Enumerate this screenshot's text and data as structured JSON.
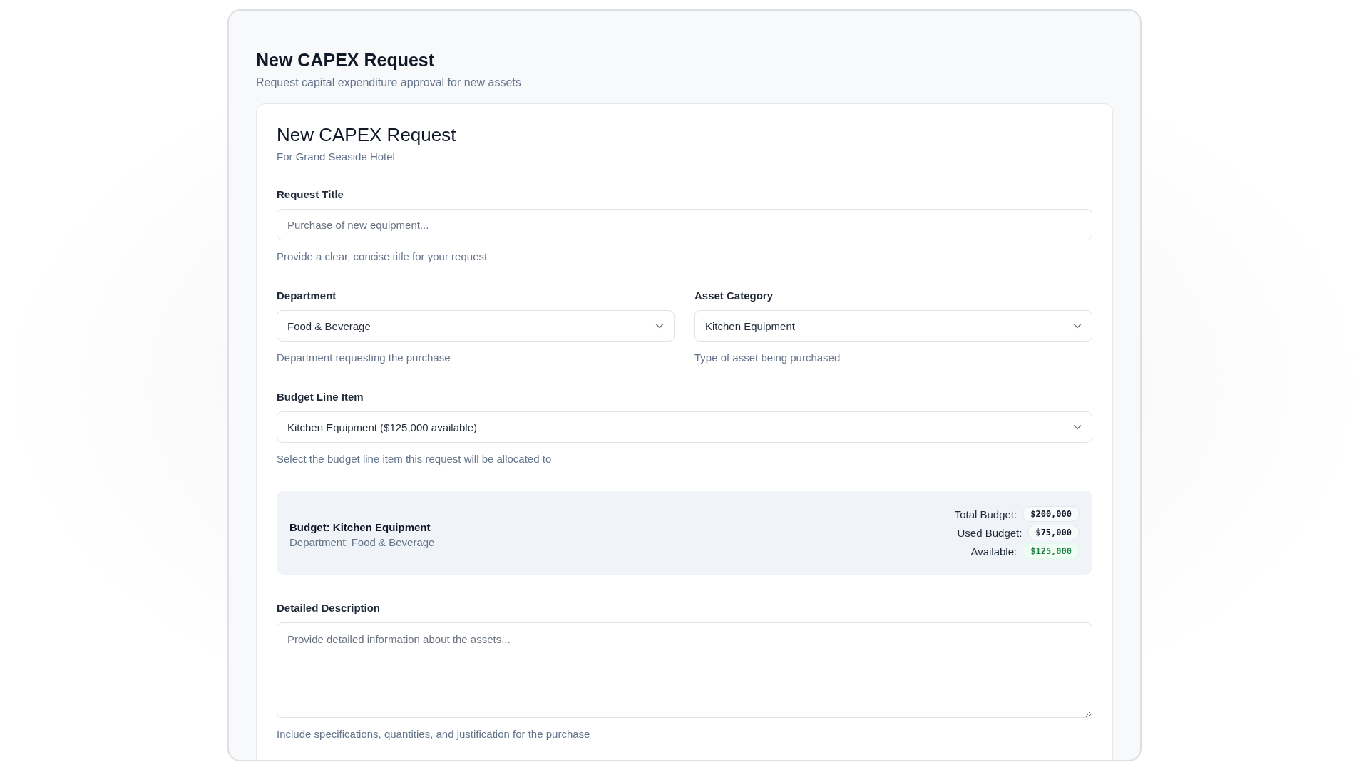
{
  "page": {
    "title": "New CAPEX Request",
    "subtitle": "Request capital expenditure approval for new assets"
  },
  "card": {
    "title": "New CAPEX Request",
    "subtitle": "For Grand Seaside Hotel",
    "rows": [
      [
        {
          "kind": "text",
          "label": "Request Title",
          "placeholder": "Purchase of new equipment...",
          "help": "Provide a clear, concise title for your request"
        }
      ],
      [
        {
          "kind": "select",
          "label": "Department",
          "value": "Food & Beverage",
          "help": "Department requesting the purchase"
        },
        {
          "kind": "select",
          "label": "Asset Category",
          "value": "Kitchen Equipment",
          "help": "Type of asset being purchased"
        }
      ],
      [
        {
          "kind": "select",
          "label": "Budget Line Item",
          "value": "Kitchen Equipment ($125,000 available)",
          "help": "Select the budget line item this request will be allocated to"
        }
      ],
      [
        {
          "kind": "budget",
          "title": "Budget: Kitchen Equipment",
          "subtitle": "Department: Food & Beverage",
          "stats": [
            {
              "label": "Total Budget:",
              "value": "$200,000",
              "highlighted": false
            },
            {
              "label": "Used Budget:",
              "value": "$75,000",
              "highlighted": false
            },
            {
              "label": "Available:",
              "value": "$125,000",
              "highlighted": true
            }
          ]
        }
      ],
      [
        {
          "kind": "textarea",
          "label": "Detailed Description",
          "placeholder": "Provide detailed information about the assets...",
          "help": "Include specifications, quantities, and justification for the purchase"
        }
      ]
    ]
  }
}
